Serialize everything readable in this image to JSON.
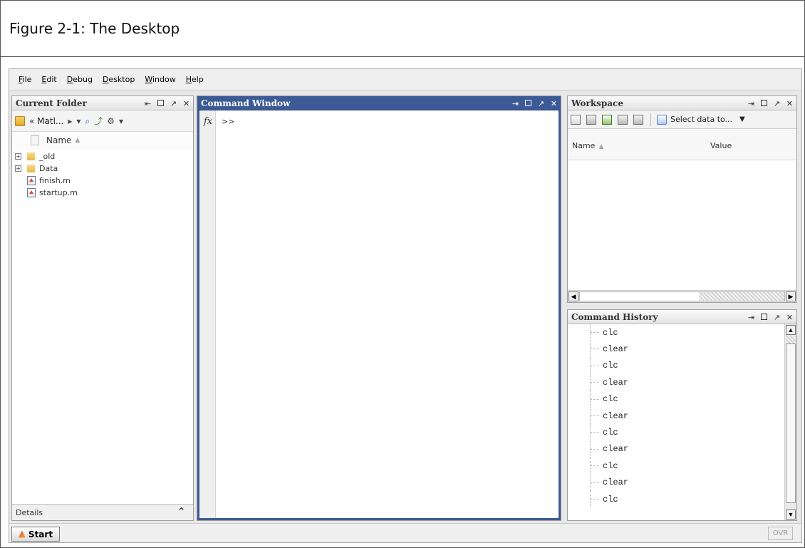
{
  "figure": {
    "caption": "Figure 2-1: The Desktop"
  },
  "menu": {
    "items": [
      "File",
      "Edit",
      "Debug",
      "Desktop",
      "Window",
      "Help"
    ]
  },
  "current_folder": {
    "title": "Current Folder",
    "path": "« Matl...",
    "columns": {
      "name": "Name"
    },
    "items": [
      {
        "name": "_old",
        "type": "folder"
      },
      {
        "name": "Data",
        "type": "folder"
      },
      {
        "name": "finish.m",
        "type": "mfile"
      },
      {
        "name": "startup.m",
        "type": "mfile"
      }
    ],
    "details_label": "Details"
  },
  "command_window": {
    "title": "Command Window",
    "prompt": ">>",
    "fx_label": "fx"
  },
  "workspace": {
    "title": "Workspace",
    "select_label": "Select data to...",
    "columns": {
      "name": "Name",
      "value": "Value"
    }
  },
  "command_history": {
    "title": "Command History",
    "entries": [
      "clc",
      "clear",
      "clc",
      "clear",
      "clc",
      "clear",
      "clc",
      "clear",
      "clc",
      "clear",
      "clc"
    ]
  },
  "status": {
    "start_label": "Start",
    "ovr_label": "OVR"
  },
  "colors": {
    "active_title": "#3c5a95",
    "accent_border": "#3c5a95"
  }
}
